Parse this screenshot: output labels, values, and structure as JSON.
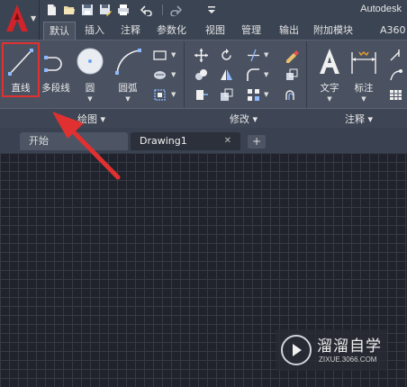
{
  "app": {
    "title": "Autodesk",
    "logo_color": "#d2232a"
  },
  "quick_access": [
    "new-icon",
    "open-icon",
    "save-icon",
    "saveas-icon",
    "print-icon",
    "undo-icon",
    "redo-icon",
    "customize-icon"
  ],
  "ribbon_tabs": [
    {
      "label": "默认",
      "active": true
    },
    {
      "label": "插入"
    },
    {
      "label": "注释"
    },
    {
      "label": "参数化"
    },
    {
      "label": "视图"
    },
    {
      "label": "管理"
    },
    {
      "label": "输出"
    },
    {
      "label": "附加模块"
    },
    {
      "label": "A360"
    }
  ],
  "draw_panel": {
    "title": "绘图",
    "tools": [
      {
        "label": "直线"
      },
      {
        "label": "多段线"
      },
      {
        "label": "圆"
      },
      {
        "label": "圆弧"
      }
    ]
  },
  "modify_panel": {
    "title": "修改"
  },
  "annotation_panel": {
    "title": "注释",
    "tools": [
      {
        "label": "文字"
      },
      {
        "label": "标注"
      }
    ]
  },
  "doc_tabs": [
    {
      "label": "开始"
    },
    {
      "label": "Drawing1",
      "active": true
    }
  ],
  "accent_colors": {
    "highlight": "#e03030",
    "arrow": "#e03030"
  },
  "watermark": {
    "title": "溜溜自学",
    "url": "ZIXUE.3066.COM"
  }
}
